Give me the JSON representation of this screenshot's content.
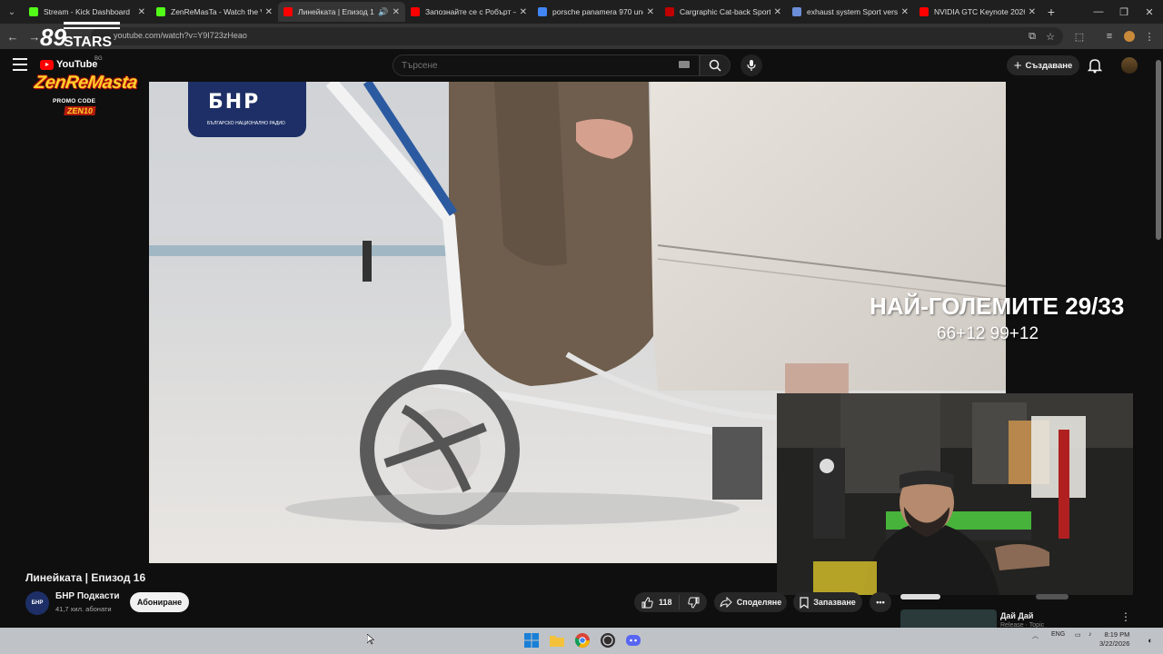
{
  "browser": {
    "tabs": [
      {
        "title": "Stream - Kick Dashboard",
        "favicon": "kick-icon",
        "color": "#53fc18",
        "active": false
      },
      {
        "title": "ZenReMasTa - Watch the VO",
        "favicon": "kick-icon",
        "color": "#53fc18",
        "active": false
      },
      {
        "title": "Линейката | Епизод 16",
        "favicon": "youtube-icon",
        "color": "#ff0000",
        "active": true,
        "audio": true
      },
      {
        "title": "Запознайте се с Робърт – п",
        "favicon": "youtube-icon",
        "color": "#ff0000",
        "active": false
      },
      {
        "title": "porsche panamera 970 unde",
        "favicon": "google-icon",
        "color": "#4285f4",
        "active": false
      },
      {
        "title": "Cargraphic Cat-back Sport E",
        "favicon": "cargraphic-icon",
        "color": "#c00000",
        "active": false
      },
      {
        "title": "exhaust system Sport versio",
        "favicon": "site-icon",
        "color": "#6a8fd8",
        "active": false
      },
      {
        "title": "NVIDIA GTC Keynote 2026 -",
        "favicon": "youtube-icon",
        "color": "#ff0000",
        "active": false
      }
    ],
    "url": "youtube.com/watch?v=Y9I723zHeao"
  },
  "overlay": {
    "stars_text": "STARS",
    "stars_number": "89",
    "zen_title": "ZenReMasta",
    "zen_promo": "PROMO CODE",
    "zen_code": "ZEN10",
    "youtube_logo": "YouTube",
    "youtube_region": "BG"
  },
  "youtube": {
    "search_placeholder": "Търсене",
    "create_label": "Създаване"
  },
  "video": {
    "bnr_logo": "БНР",
    "bnr_sub": "БЪЛГАРСКО НАЦИОНАЛНО РАДИО",
    "overlay_title": "НАЙ-ГОЛЕМИТЕ 29/33",
    "overlay_sub": "66+12 99+12"
  },
  "info": {
    "title": "Линейката | Епизод 16",
    "channel": "БНР Подкасти",
    "channel_avatar_text": "БНР",
    "subscribers": "41,7 хил. абонати",
    "subscribe_label": "Абониране",
    "likes": "118",
    "share_label": "Споделяне",
    "save_label": "Запазване"
  },
  "recommended": {
    "title": "Дай Дай",
    "subtitle": "Release · Topic"
  },
  "taskbar": {
    "lang": "ENG",
    "time": "8:19 PM",
    "date": "3/22/2026"
  }
}
